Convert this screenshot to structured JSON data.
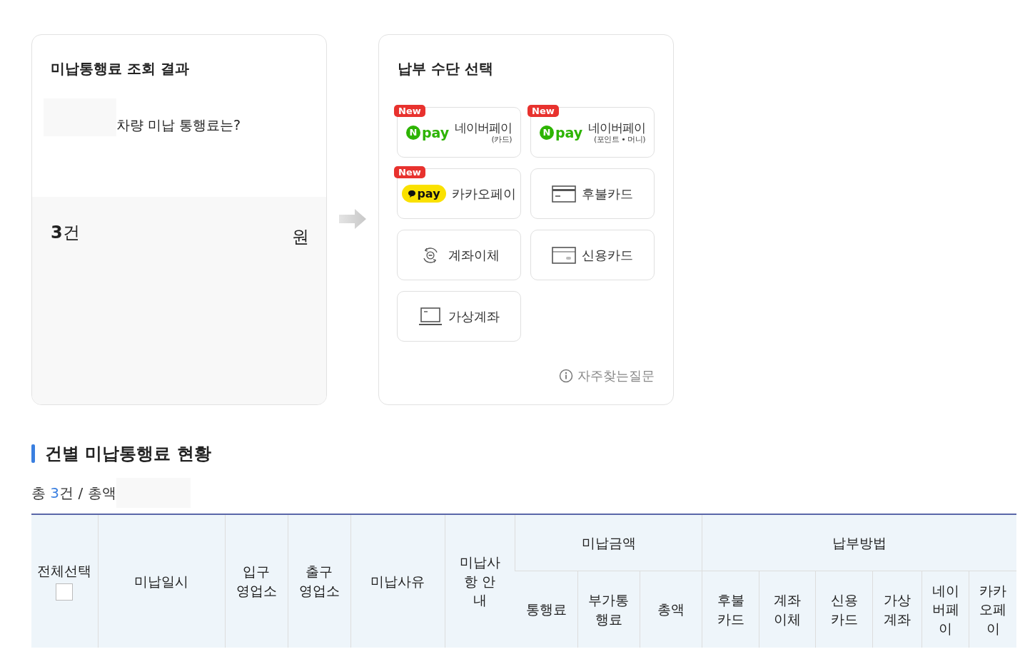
{
  "result_card": {
    "title": "미납통행료 조회 결과",
    "question": "차량 미납 통행료는?",
    "count": "**3**건",
    "currency": "원"
  },
  "payment_card": {
    "title": "납부 수단 선택",
    "options": [
      {
        "kind": "npay",
        "badge": "New",
        "logo_letter": "N",
        "logo_text": "pay",
        "label": "네이버페이",
        "sublabel": "(카드)"
      },
      {
        "kind": "npay",
        "badge": "New",
        "logo_letter": "N",
        "logo_text": "pay",
        "label": "네이버페이",
        "sublabel": "(포인트 • 머니)"
      },
      {
        "kind": "kakaopay",
        "badge": "New",
        "logo_text": "pay",
        "label": "카카오페이"
      },
      {
        "kind": "deferred_card",
        "label": "후불카드"
      },
      {
        "kind": "transfer",
        "label": "계좌이체"
      },
      {
        "kind": "credit_card",
        "label": "신용카드"
      },
      {
        "kind": "virtual_account",
        "label": "가상계좌"
      }
    ],
    "faq_link": "자주찾는질문"
  },
  "section": {
    "title": "건별 미납통행료 현황",
    "summary_prefix": "총",
    "summary_count": "3",
    "summary_suffix": "건 / 총액"
  },
  "table": {
    "select_all": {
      "label": "전체선택",
      "checked": false
    },
    "columns": [
      "미납일시",
      "입구 영업소",
      "출구 영업소",
      "미납사유",
      "미납사항 안내"
    ],
    "groups": [
      {
        "label": "미납금액",
        "columns": [
          "통행료",
          "부가통행료",
          "총액"
        ]
      },
      {
        "label": "납부방법",
        "columns": [
          "후불카드",
          "계좌이체",
          "신용카드",
          "가상계좌",
          "네이버페이",
          "카카오페이"
        ]
      }
    ]
  }
}
